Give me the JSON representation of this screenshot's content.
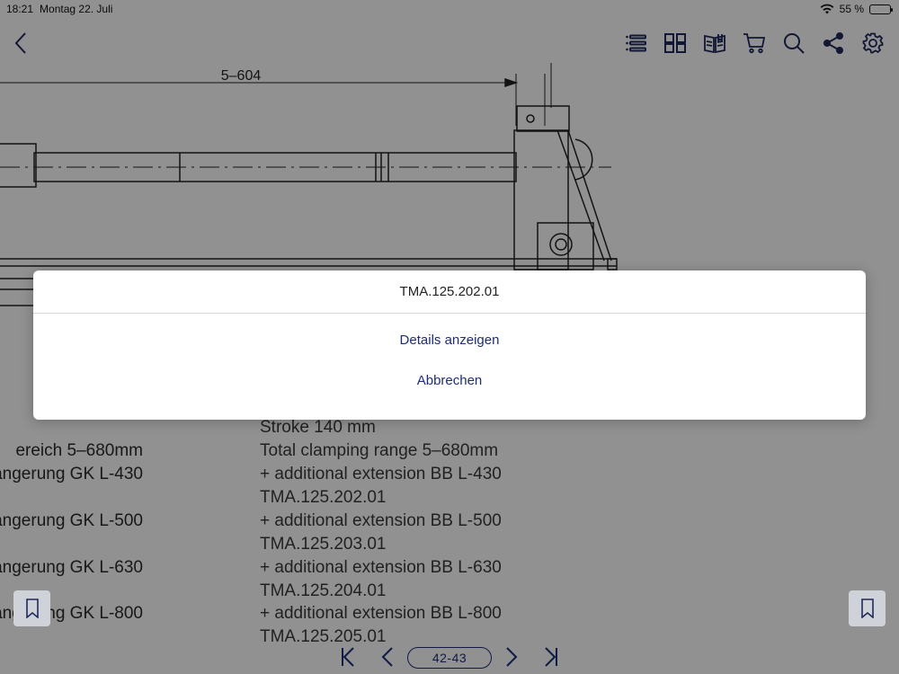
{
  "status": {
    "time": "18:21",
    "date": "Montag 22. Juli",
    "battery": "55 %",
    "battery_level": 0.55
  },
  "toolbar": {
    "icons": [
      "list-icon",
      "grid-icon",
      "catalog-icon",
      "cart-icon",
      "search-icon",
      "share-icon",
      "gear-icon"
    ]
  },
  "drawing": {
    "dimension": "5–604"
  },
  "specs": [
    {
      "de": "ereich 5–680mm",
      "en": "Total clamping range 5–680mm"
    },
    {
      "de": "ängerung GK L-430",
      "en": "+ additional extension BB L-430"
    },
    {
      "de": "",
      "en": "TMA.125.202.01"
    },
    {
      "de": "ängerung GK L-500",
      "en": "+ additional extension BB L-500"
    },
    {
      "de": "",
      "en": "TMA.125.203.01"
    },
    {
      "de": "ängerung GK L-630",
      "en": "+ additional extension BB L-630"
    },
    {
      "de": "",
      "en": "TMA.125.204.01"
    },
    {
      "de": "ängerung GK L-800",
      "en": "+ additional extension BB L-800"
    },
    {
      "de": "",
      "en": "TMA.125.205.01"
    }
  ],
  "stroke_line": "Stroke 140 mm",
  "sheet": {
    "title": "TMA.125.202.01",
    "details_label": "Details anzeigen",
    "cancel_label": "Abbrechen"
  },
  "pagination": {
    "current": "42-43"
  }
}
